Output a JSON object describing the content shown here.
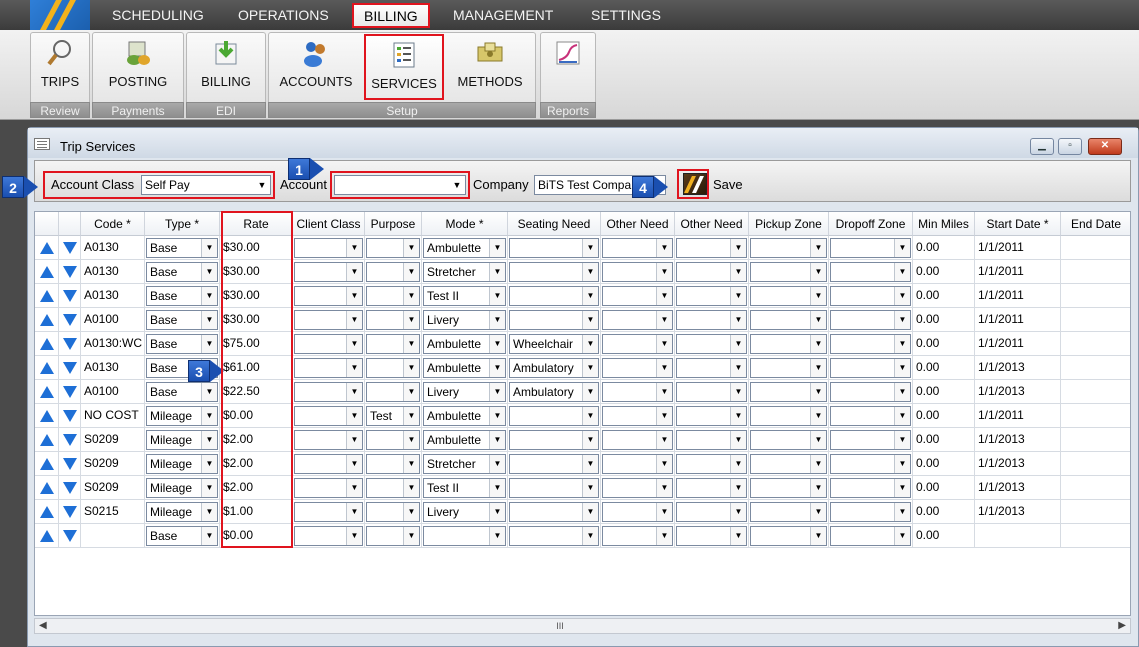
{
  "menu": {
    "items": [
      "SCHEDULING",
      "OPERATIONS",
      "BILLING",
      "MANAGEMENT",
      "SETTINGS"
    ],
    "active": "BILLING"
  },
  "ribbon": {
    "groups": [
      {
        "label": "Review",
        "buttons": [
          {
            "label": "TRIPS",
            "icon": "trips-icon"
          }
        ]
      },
      {
        "label": "Payments",
        "buttons": [
          {
            "label": "POSTING",
            "icon": "posting-icon"
          }
        ]
      },
      {
        "label": "EDI",
        "buttons": [
          {
            "label": "BILLING",
            "icon": "billing-edi-icon"
          }
        ]
      },
      {
        "label": "Setup",
        "buttons": [
          {
            "label": "ACCOUNTS",
            "icon": "accounts-icon"
          },
          {
            "label": "SERVICES",
            "icon": "services-icon"
          },
          {
            "label": "METHODS",
            "icon": "methods-icon"
          }
        ]
      },
      {
        "label": "Reports",
        "buttons": [
          {
            "label": "",
            "icon": "reports-chart-icon"
          }
        ]
      }
    ]
  },
  "window": {
    "title": "Trip Services",
    "toolbar": {
      "account_class_label": "Account Class",
      "account_class_value": "Self Pay",
      "account_label": "Account",
      "account_value": "",
      "company_label": "Company",
      "company_value": "BiTS Test Compa",
      "save_label": "Save"
    },
    "callouts": [
      "1",
      "2",
      "3",
      "4"
    ],
    "grid": {
      "columns": [
        "Code *",
        "Type *",
        "Rate",
        "Client Class",
        "Purpose",
        "Mode *",
        "Seating Need",
        "Other Need",
        "Other Need",
        "Pickup Zone",
        "Dropoff Zone",
        "Min Miles",
        "Start Date *",
        "End Date"
      ],
      "rows": [
        {
          "code": "A0130",
          "type": "Base",
          "rate": "$30.00",
          "client_class": "",
          "purpose": "",
          "mode": "Ambulette",
          "seating": "",
          "other1": "",
          "other2": "",
          "pickup": "",
          "dropoff": "",
          "min_miles": "0.00",
          "start": "1/1/2011",
          "end": ""
        },
        {
          "code": "A0130",
          "type": "Base",
          "rate": "$30.00",
          "client_class": "",
          "purpose": "",
          "mode": "Stretcher",
          "seating": "",
          "other1": "",
          "other2": "",
          "pickup": "",
          "dropoff": "",
          "min_miles": "0.00",
          "start": "1/1/2011",
          "end": ""
        },
        {
          "code": "A0130",
          "type": "Base",
          "rate": "$30.00",
          "client_class": "",
          "purpose": "",
          "mode": "Test II",
          "seating": "",
          "other1": "",
          "other2": "",
          "pickup": "",
          "dropoff": "",
          "min_miles": "0.00",
          "start": "1/1/2011",
          "end": ""
        },
        {
          "code": "A0100",
          "type": "Base",
          "rate": "$30.00",
          "client_class": "",
          "purpose": "",
          "mode": "Livery",
          "seating": "",
          "other1": "",
          "other2": "",
          "pickup": "",
          "dropoff": "",
          "min_miles": "0.00",
          "start": "1/1/2011",
          "end": ""
        },
        {
          "code": "A0130:WC",
          "type": "Base",
          "rate": "$75.00",
          "client_class": "",
          "purpose": "",
          "mode": "Ambulette",
          "seating": "Wheelchair",
          "other1": "",
          "other2": "",
          "pickup": "",
          "dropoff": "",
          "min_miles": "0.00",
          "start": "1/1/2011",
          "end": ""
        },
        {
          "code": "A0130",
          "type": "Base",
          "rate": "$61.00",
          "client_class": "",
          "purpose": "",
          "mode": "Ambulette",
          "seating": "Ambulatory",
          "other1": "",
          "other2": "",
          "pickup": "",
          "dropoff": "",
          "min_miles": "0.00",
          "start": "1/1/2013",
          "end": ""
        },
        {
          "code": "A0100",
          "type": "Base",
          "rate": "$22.50",
          "client_class": "",
          "purpose": "",
          "mode": "Livery",
          "seating": "Ambulatory",
          "other1": "",
          "other2": "",
          "pickup": "",
          "dropoff": "",
          "min_miles": "0.00",
          "start": "1/1/2013",
          "end": ""
        },
        {
          "code": "NO COST",
          "type": "Mileage",
          "rate": "$0.00",
          "client_class": "",
          "purpose": "Test",
          "mode": "Ambulette",
          "seating": "",
          "other1": "",
          "other2": "",
          "pickup": "",
          "dropoff": "",
          "min_miles": "0.00",
          "start": "1/1/2011",
          "end": ""
        },
        {
          "code": "S0209",
          "type": "Mileage",
          "rate": "$2.00",
          "client_class": "",
          "purpose": "",
          "mode": "Ambulette",
          "seating": "",
          "other1": "",
          "other2": "",
          "pickup": "",
          "dropoff": "",
          "min_miles": "0.00",
          "start": "1/1/2013",
          "end": ""
        },
        {
          "code": "S0209",
          "type": "Mileage",
          "rate": "$2.00",
          "client_class": "",
          "purpose": "",
          "mode": "Stretcher",
          "seating": "",
          "other1": "",
          "other2": "",
          "pickup": "",
          "dropoff": "",
          "min_miles": "0.00",
          "start": "1/1/2013",
          "end": ""
        },
        {
          "code": "S0209",
          "type": "Mileage",
          "rate": "$2.00",
          "client_class": "",
          "purpose": "",
          "mode": "Test II",
          "seating": "",
          "other1": "",
          "other2": "",
          "pickup": "",
          "dropoff": "",
          "min_miles": "0.00",
          "start": "1/1/2013",
          "end": ""
        },
        {
          "code": "S0215",
          "type": "Mileage",
          "rate": "$1.00",
          "client_class": "",
          "purpose": "",
          "mode": "Livery",
          "seating": "",
          "other1": "",
          "other2": "",
          "pickup": "",
          "dropoff": "",
          "min_miles": "0.00",
          "start": "1/1/2013",
          "end": ""
        },
        {
          "code": "",
          "type": "Base",
          "rate": "$0.00",
          "client_class": "",
          "purpose": "",
          "mode": "",
          "seating": "",
          "other1": "",
          "other2": "",
          "pickup": "",
          "dropoff": "",
          "min_miles": "0.00",
          "start": "",
          "end": ""
        }
      ]
    },
    "hscroll_thumb": "III"
  },
  "colors": {
    "accent_red": "#e0141e",
    "callout_blue": "#1a4fb0",
    "arrow_blue": "#1e6fd6"
  }
}
